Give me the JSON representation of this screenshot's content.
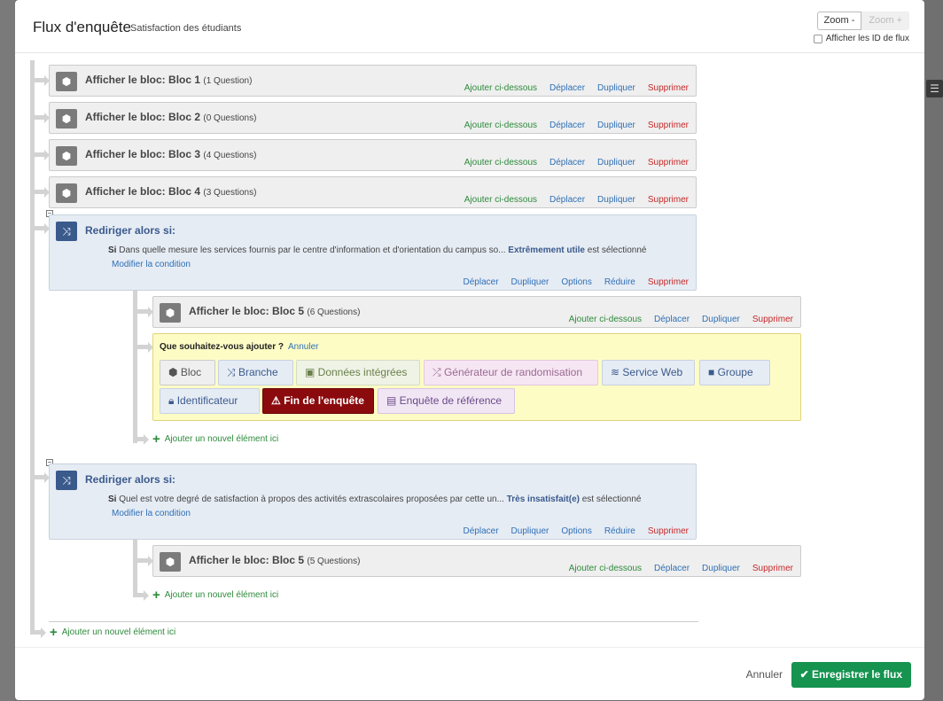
{
  "header": {
    "title": "Flux d'enquête",
    "subtitle": "Satisfaction des étudiants",
    "zoom_out": "Zoom -",
    "zoom_in": "Zoom +",
    "show_ids": "Afficher les ID de flux"
  },
  "labels": {
    "show_block": "Afficher le bloc:",
    "redirect": "Rediriger alors si:",
    "si": "Si",
    "selected": "est sélectionné",
    "modify": "Modifier la condition",
    "add_below": "Ajouter ci-dessous",
    "move": "Déplacer",
    "duplicate": "Dupliquer",
    "delete": "Supprimer",
    "options": "Options",
    "collapse": "Réduire",
    "add_new": "Ajouter un nouvel élément ici"
  },
  "blocks": [
    {
      "name": "Bloc 1",
      "count": "(1 Question)"
    },
    {
      "name": "Bloc 2",
      "count": "(0 Questions)"
    },
    {
      "name": "Bloc 3",
      "count": "(4 Questions)"
    },
    {
      "name": "Bloc 4",
      "count": "(3 Questions)"
    },
    {
      "name": "Bloc 5",
      "count": "(6 Questions)"
    },
    {
      "name": "Bloc 5",
      "count": "(5 Questions)"
    }
  ],
  "branches": [
    {
      "question": "Dans quelle mesure les services fournis par le centre d'information et d'orientation du campus so...",
      "answer": "Extrêmement utile"
    },
    {
      "question": "Quel est votre degré de satisfaction à propos des activités extrascolaires proposées par cette un...",
      "answer": "Très insatisfait(e)"
    }
  ],
  "add_panel": {
    "title": "Que souhaitez-vous ajouter ?",
    "cancel": "Annuler",
    "options": [
      {
        "label": "Bloc",
        "icon": "cube-icon"
      },
      {
        "label": "Branche",
        "icon": "branch-icon"
      },
      {
        "label": "Données intégrées",
        "icon": "embedded-data-icon"
      },
      {
        "label": "Générateur de randomisation",
        "icon": "shuffle-icon"
      },
      {
        "label": "Service Web",
        "icon": "rss-icon"
      },
      {
        "label": "Groupe",
        "icon": "folder-icon"
      },
      {
        "label": "Identificateur",
        "icon": "lock-icon"
      },
      {
        "label": "Fin de l'enquête",
        "icon": "warning-icon"
      },
      {
        "label": "Enquête de référence",
        "icon": "clipboard-icon"
      }
    ]
  },
  "footer": {
    "cancel": "Annuler",
    "save": "Enregistrer le flux"
  }
}
